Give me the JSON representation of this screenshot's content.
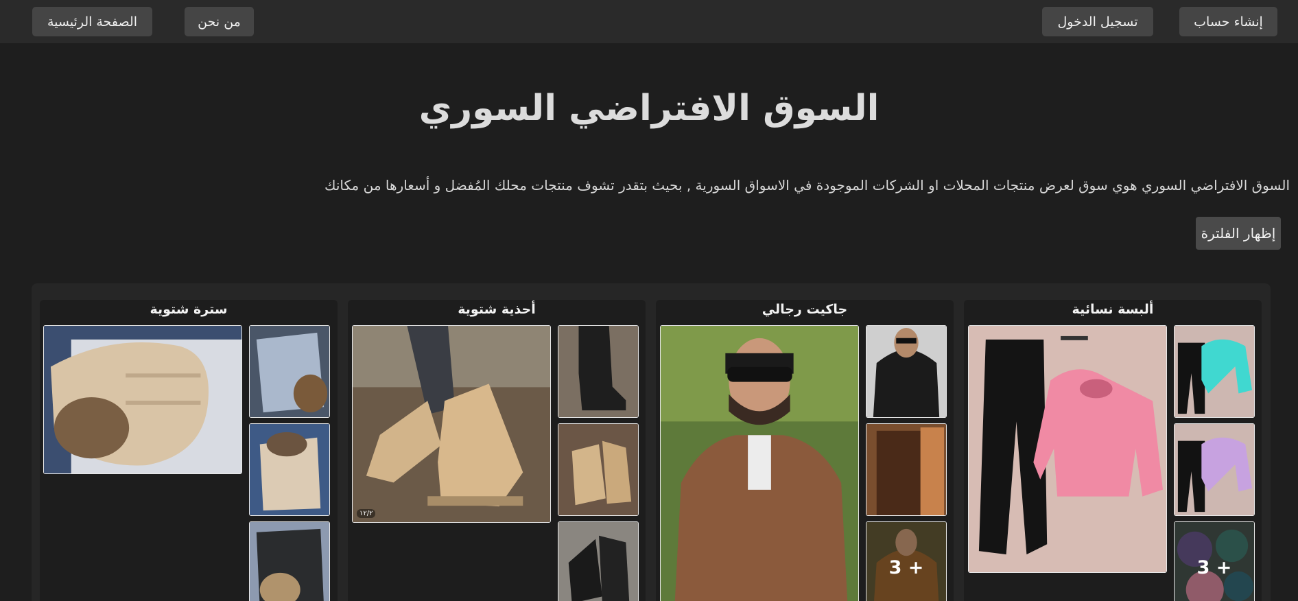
{
  "nav": {
    "home": "الصفحة الرئيسية",
    "about": "من نحن",
    "login": "تسجيل الدخول",
    "signup": "إنشاء حساب"
  },
  "hero": {
    "title": "السوق الافتراضي السوري",
    "description": "السوق الافتراضي السوري هوي سوق لعرض منتجات المحلات او الشركات الموجودة في الاسواق السورية , بحيث بتقدر تشوف منتجات محلك المُفضل و أسعارها من مكانك"
  },
  "filter": {
    "label": "إظهار الفلترة"
  },
  "categories": [
    {
      "title": "ألبسة نسائية",
      "more": "3 +"
    },
    {
      "title": "جاكيت رجالي",
      "more": "3 +"
    },
    {
      "title": "أحذية شتوية"
    },
    {
      "title": "سترة شتوية"
    }
  ],
  "image_badge": "١٢/٢",
  "colors": {
    "page_bg": "#1e1e1e",
    "topbar_bg": "#2a2a2a",
    "button_bg": "#454545",
    "card_bg": "#1d1d1d",
    "container_bg": "#262626"
  }
}
